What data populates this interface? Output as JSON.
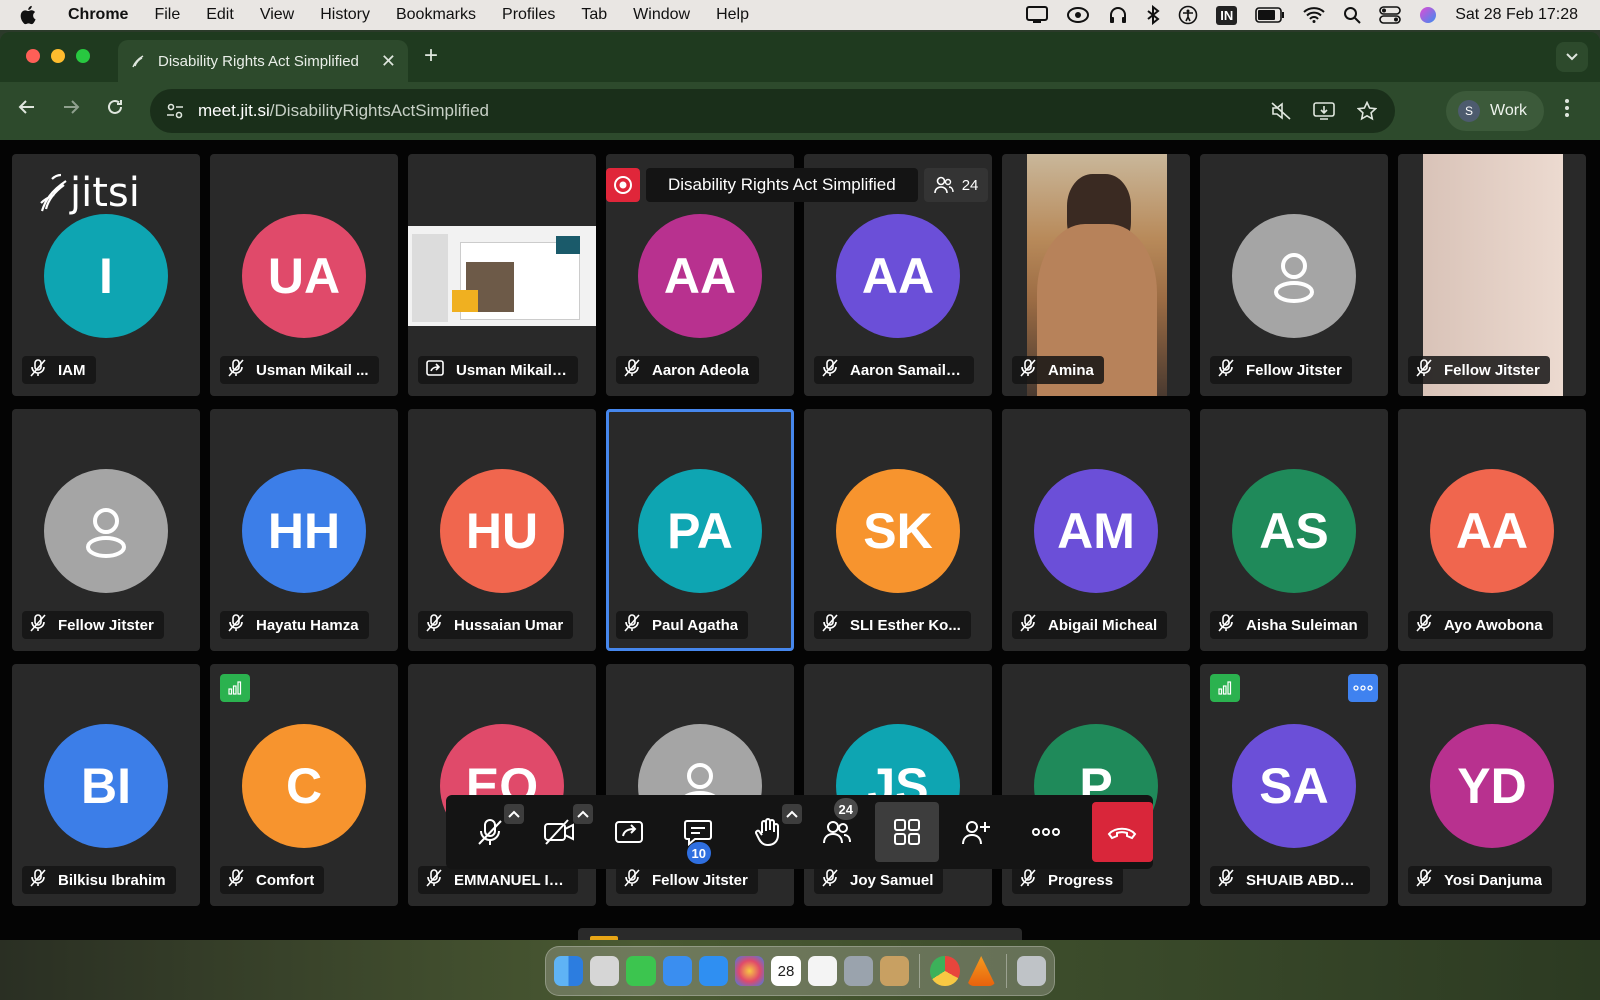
{
  "menubar": {
    "app": "Chrome",
    "items": [
      "File",
      "Edit",
      "View",
      "History",
      "Bookmarks",
      "Profiles",
      "Tab",
      "Window",
      "Help"
    ],
    "input_badge": "IN",
    "datetime": "Sat 28 Feb  17:28"
  },
  "browser": {
    "tab_title": "Disability Rights Act Simplified",
    "url_host": "meet.jit.si",
    "url_path": "/DisabilityRightsActSimplified",
    "profile_initial": "S",
    "profile_name": "Work"
  },
  "meeting": {
    "logo": "jitsi",
    "title": "Disability Rights Act Simplified",
    "participant_count": "24",
    "recording": true
  },
  "participants": [
    {
      "name": "IAM",
      "initials": "I",
      "color": "#0ea5b2",
      "type": "avatar",
      "label_icon": "mic-muted"
    },
    {
      "name": "Usman Mikail ...",
      "initials": "UA",
      "color": "#e04a6a",
      "type": "avatar",
      "label_icon": "mic-muted"
    },
    {
      "name": "Usman Mikail ...",
      "initials": "",
      "color": "",
      "type": "screenshare",
      "label_icon": "screen-share"
    },
    {
      "name": "Aaron Adeola",
      "initials": "AA",
      "color": "#b8318f",
      "type": "avatar",
      "label_icon": "mic-muted"
    },
    {
      "name": "Aaron Samaila...",
      "initials": "AA",
      "color": "#6b4fd8",
      "type": "avatar",
      "label_icon": "mic-muted"
    },
    {
      "name": "Amina",
      "initials": "",
      "color": "",
      "type": "video",
      "label_icon": "mic-muted"
    },
    {
      "name": "Fellow Jitster",
      "initials": "",
      "color": "#a5a5a5",
      "type": "placeholder",
      "label_icon": "mic-muted"
    },
    {
      "name": "Fellow Jitster",
      "initials": "",
      "color": "",
      "type": "video-light",
      "label_icon": "mic-muted"
    },
    {
      "name": "Fellow Jitster",
      "initials": "",
      "color": "#a5a5a5",
      "type": "placeholder",
      "label_icon": "mic-muted"
    },
    {
      "name": "Hayatu Hamza",
      "initials": "HH",
      "color": "#3c7ee8",
      "type": "avatar",
      "label_icon": "mic-muted"
    },
    {
      "name": "Hussaian Umar",
      "initials": "HU",
      "color": "#f0664e",
      "type": "avatar",
      "label_icon": "mic-muted"
    },
    {
      "name": "Paul Agatha",
      "initials": "PA",
      "color": "#0ea5b2",
      "type": "avatar",
      "label_icon": "mic-muted",
      "active": true
    },
    {
      "name": "SLI Esther Ko...",
      "initials": "SK",
      "color": "#f7942e",
      "type": "avatar",
      "label_icon": "mic-muted"
    },
    {
      "name": "Abigail Micheal",
      "initials": "AM",
      "color": "#6b4fd8",
      "type": "avatar",
      "label_icon": "mic-muted"
    },
    {
      "name": "Aisha Suleiman",
      "initials": "AS",
      "color": "#1f8a5a",
      "type": "avatar",
      "label_icon": "mic-muted"
    },
    {
      "name": "Ayo Awobona",
      "initials": "AA",
      "color": "#f0664e",
      "type": "avatar",
      "label_icon": "mic-muted"
    },
    {
      "name": "Bilkisu Ibrahim",
      "initials": "BI",
      "color": "#3c7ee8",
      "type": "avatar",
      "label_icon": "mic-muted"
    },
    {
      "name": "Comfort",
      "initials": "C",
      "color": "#f7942e",
      "type": "avatar",
      "label_icon": "mic-muted",
      "connection": true
    },
    {
      "name": "EMMANUEL ID...",
      "initials": "EO",
      "color": "#e04a6a",
      "type": "avatar",
      "label_icon": "mic-muted"
    },
    {
      "name": "Fellow Jitster",
      "initials": "",
      "color": "#a5a5a5",
      "type": "placeholder",
      "label_icon": "mic-muted"
    },
    {
      "name": "Joy Samuel",
      "initials": "JS",
      "color": "#0ea5b2",
      "type": "avatar",
      "label_icon": "mic-muted"
    },
    {
      "name": "Progress",
      "initials": "P",
      "color": "#1f8a5a",
      "type": "avatar",
      "label_icon": "mic-muted"
    },
    {
      "name": "SHUAIB ABDO...",
      "initials": "SA",
      "color": "#6b4fd8",
      "type": "avatar",
      "label_icon": "mic-muted",
      "connection": true,
      "more": true
    },
    {
      "name": "Yosi Danjuma",
      "initials": "YD",
      "color": "#b8318f",
      "type": "avatar",
      "label_icon": "mic-muted"
    }
  ],
  "toolbox": {
    "buttons": [
      "microphone",
      "camera",
      "share-screen",
      "chat",
      "raise-hand",
      "participants",
      "tile-view",
      "invite",
      "more",
      "hangup"
    ],
    "chat_unread": "10",
    "participants_badge": "24"
  },
  "dock": {
    "calendar_day": "28",
    "apps": [
      "Finder",
      "Launchpad",
      "Messages",
      "Mail",
      "App Store",
      "Photos",
      "Calendar",
      "Reminders",
      "System Settings",
      "Preview",
      "Chrome",
      "VLC",
      "Trash"
    ]
  },
  "colors": {
    "chrome_frame": "#1f3a1f",
    "chrome_toolbar": "#2d4a2c",
    "jitsi_bg": "#040404",
    "tile_bg": "#292929",
    "active_outline": "#4687ed",
    "record_red": "#e0263a",
    "hangup_red": "#d9263a"
  }
}
